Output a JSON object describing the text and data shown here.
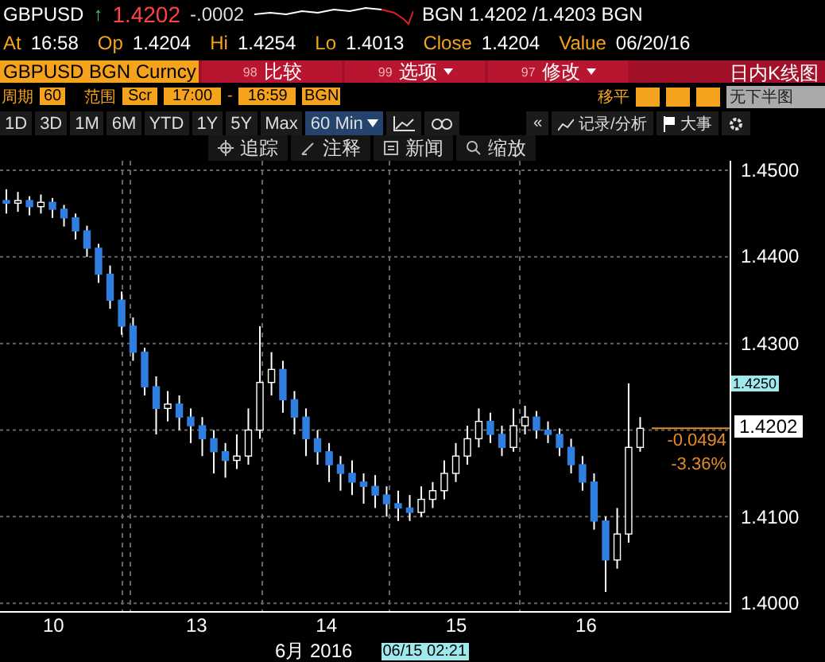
{
  "quote": {
    "symbol": "GBPUSD",
    "direction_arrow": "↑",
    "last": "1.4202",
    "change": "-.0002",
    "bid_ask": "BGN 1.4202 /1.4203 BGN"
  },
  "stats": [
    {
      "label": "At",
      "value": "16:58"
    },
    {
      "label": "Op",
      "value": "1.4204"
    },
    {
      "label": "Hi",
      "value": "1.4254"
    },
    {
      "label": "Lo",
      "value": "1.4013"
    },
    {
      "label": "Close",
      "value": "1.4204"
    },
    {
      "label": "Value",
      "value": "06/20/16"
    }
  ],
  "command_bar": {
    "security": "GBPUSD BGN Curncy",
    "actions": [
      {
        "code": "98",
        "label": "比较",
        "dropdown": false
      },
      {
        "code": "99",
        "label": "选项",
        "dropdown": true
      },
      {
        "code": "97",
        "label": "修改",
        "dropdown": true
      }
    ],
    "title": "日内K线图"
  },
  "settings": {
    "period_label": "周期",
    "period": "60",
    "range_label": "范围",
    "range_mode": "Scr",
    "start": "17:00",
    "dash": "-",
    "end": "16:59",
    "source": "BGN",
    "smooth_label": "移平",
    "lower_chart": "无下半图"
  },
  "periods": [
    {
      "label": "1D",
      "selected": false,
      "dropdown": false
    },
    {
      "label": "3D",
      "selected": false,
      "dropdown": false
    },
    {
      "label": "1M",
      "selected": false,
      "dropdown": false
    },
    {
      "label": "6M",
      "selected": false,
      "dropdown": false
    },
    {
      "label": "YTD",
      "selected": false,
      "dropdown": false
    },
    {
      "label": "1Y",
      "selected": false,
      "dropdown": false
    },
    {
      "label": "5Y",
      "selected": false,
      "dropdown": false
    },
    {
      "label": "Max",
      "selected": false,
      "dropdown": false
    },
    {
      "label": "60 Min",
      "selected": true,
      "dropdown": true
    }
  ],
  "chart_tools": {
    "collapse": "«",
    "analysis": "记录/分析",
    "events": "大事"
  },
  "toolbar": [
    {
      "kind": "track",
      "label": "追踪"
    },
    {
      "kind": "annotate",
      "label": "注释"
    },
    {
      "kind": "news",
      "label": "新闻"
    },
    {
      "kind": "zoom",
      "label": "缩放"
    }
  ],
  "chart": {
    "first_day_label": "10",
    "high_badge": "1.4250",
    "last_tag": "1.4202",
    "net_change": "-0.0494",
    "pct_change": "-3.36%",
    "month": "6月 2016",
    "cursor_time": "06/15 02:21",
    "chart_data": {
      "type": "candlestick",
      "ylim": [
        1.3991,
        1.4511
      ],
      "yticks": [
        {
          "value": 1.45,
          "label": "1.4500"
        },
        {
          "value": 1.44,
          "label": "1.4400"
        },
        {
          "value": 1.43,
          "label": "1.4300"
        },
        {
          "value": 1.41,
          "label": "1.4100"
        },
        {
          "value": 1.4,
          "label": "1.4000"
        }
      ],
      "grid": true,
      "xlim": [
        11.494,
        17.114
      ],
      "xticks": [
        {
          "value": 13,
          "label": "13"
        },
        {
          "value": 14,
          "label": "14"
        },
        {
          "value": 15,
          "label": "15"
        },
        {
          "value": 16,
          "label": "16"
        }
      ],
      "x": [
        11.543,
        11.632,
        11.721,
        11.809,
        11.898,
        11.987,
        12.076,
        12.164,
        12.253,
        12.342,
        12.431,
        12.519,
        12.608,
        12.697,
        12.786,
        12.875,
        12.963,
        13.052,
        13.141,
        13.23,
        13.318,
        13.407,
        13.496,
        13.585,
        13.673,
        13.762,
        13.851,
        13.94,
        14.029,
        14.117,
        14.206,
        14.295,
        14.384,
        14.472,
        14.561,
        14.65,
        14.739,
        14.827,
        14.916,
        15.005,
        15.094,
        15.182,
        15.271,
        15.36,
        15.449,
        15.538,
        15.626,
        15.715,
        15.804,
        15.893,
        15.981,
        16.07,
        16.159,
        16.248,
        16.336,
        16.425
      ],
      "ohlc": [
        [
          1.4465,
          1.4478,
          1.445,
          1.4462
        ],
        [
          1.4462,
          1.4475,
          1.4452,
          1.4465
        ],
        [
          1.4465,
          1.447,
          1.4448,
          1.4458
        ],
        [
          1.4458,
          1.4472,
          1.445,
          1.4463
        ],
        [
          1.4463,
          1.4468,
          1.4445,
          1.4455
        ],
        [
          1.4455,
          1.446,
          1.4435,
          1.4445
        ],
        [
          1.4445,
          1.445,
          1.442,
          1.443
        ],
        [
          1.443,
          1.4436,
          1.44,
          1.441
        ],
        [
          1.441,
          1.4415,
          1.437,
          1.438
        ],
        [
          1.438,
          1.439,
          1.434,
          1.435
        ],
        [
          1.435,
          1.436,
          1.431,
          1.432
        ],
        [
          1.432,
          1.433,
          1.428,
          1.429
        ],
        [
          1.429,
          1.4295,
          1.424,
          1.425
        ],
        [
          1.425,
          1.4262,
          1.4195,
          1.4225
        ],
        [
          1.4225,
          1.4245,
          1.421,
          1.423
        ],
        [
          1.423,
          1.424,
          1.42,
          1.4215
        ],
        [
          1.4215,
          1.4225,
          1.4185,
          1.4205
        ],
        [
          1.4205,
          1.4215,
          1.417,
          1.419
        ],
        [
          1.419,
          1.42,
          1.415,
          1.4175
        ],
        [
          1.4175,
          1.4185,
          1.4145,
          1.4165
        ],
        [
          1.4165,
          1.4195,
          1.4155,
          1.417
        ],
        [
          1.417,
          1.4225,
          1.416,
          1.42
        ],
        [
          1.42,
          1.432,
          1.419,
          1.4255
        ],
        [
          1.4255,
          1.429,
          1.424,
          1.427
        ],
        [
          1.427,
          1.428,
          1.422,
          1.4235
        ],
        [
          1.4235,
          1.4245,
          1.4195,
          1.4215
        ],
        [
          1.4215,
          1.4225,
          1.417,
          1.419
        ],
        [
          1.419,
          1.42,
          1.416,
          1.4175
        ],
        [
          1.4175,
          1.4185,
          1.414,
          1.416
        ],
        [
          1.416,
          1.417,
          1.413,
          1.415
        ],
        [
          1.415,
          1.4165,
          1.4125,
          1.414
        ],
        [
          1.414,
          1.415,
          1.4115,
          1.4135
        ],
        [
          1.4135,
          1.4148,
          1.411,
          1.4125
        ],
        [
          1.4125,
          1.4135,
          1.41,
          1.4115
        ],
        [
          1.4115,
          1.413,
          1.4095,
          1.411
        ],
        [
          1.411,
          1.4125,
          1.4095,
          1.4105
        ],
        [
          1.4105,
          1.4135,
          1.41,
          1.412
        ],
        [
          1.412,
          1.414,
          1.411,
          1.413
        ],
        [
          1.413,
          1.4165,
          1.412,
          1.415
        ],
        [
          1.415,
          1.4185,
          1.414,
          1.417
        ],
        [
          1.417,
          1.4205,
          1.416,
          1.419
        ],
        [
          1.419,
          1.4225,
          1.418,
          1.421
        ],
        [
          1.421,
          1.422,
          1.4185,
          1.4195
        ],
        [
          1.4195,
          1.4205,
          1.417,
          1.418
        ],
        [
          1.418,
          1.4225,
          1.4175,
          1.4205
        ],
        [
          1.4205,
          1.4228,
          1.4195,
          1.4215
        ],
        [
          1.4215,
          1.4222,
          1.419,
          1.42
        ],
        [
          1.42,
          1.421,
          1.4185,
          1.4195
        ],
        [
          1.4195,
          1.4202,
          1.417,
          1.418
        ],
        [
          1.418,
          1.419,
          1.415,
          1.416
        ],
        [
          1.416,
          1.417,
          1.413,
          1.414
        ],
        [
          1.414,
          1.415,
          1.4085,
          1.4095
        ],
        [
          1.4095,
          1.41,
          1.4013,
          1.405
        ],
        [
          1.405,
          1.411,
          1.404,
          1.408
        ],
        [
          1.408,
          1.4254,
          1.407,
          1.418
        ],
        [
          1.418,
          1.4215,
          1.4175,
          1.4202
        ]
      ]
    }
  }
}
